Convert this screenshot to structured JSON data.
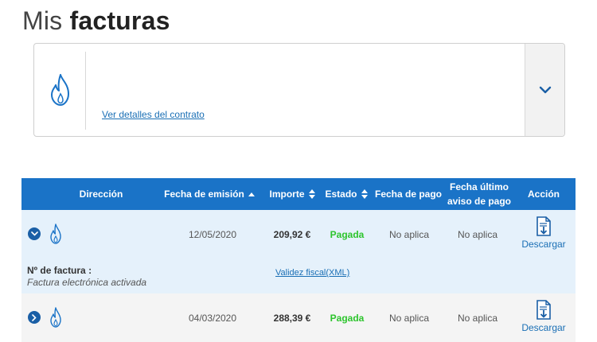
{
  "page": {
    "title_light": "Mis",
    "title_bold": "facturas"
  },
  "contract": {
    "details_link": "Ver detalles del contrato",
    "icon": "gas-flame-icon",
    "toggle_icon": "chevron-down-icon"
  },
  "table": {
    "headers": {
      "direccion": "Dirección",
      "fecha_emision": "Fecha de emisión",
      "importe": "Importe",
      "estado": "Estado",
      "fecha_pago": "Fecha de pago",
      "fecha_aviso_line1": "Fecha último",
      "fecha_aviso_line2": "aviso de pago",
      "accion": "Acción"
    },
    "rows": [
      {
        "fecha_emision": "12/05/2020",
        "importe": "209,92 €",
        "estado": "Pagada",
        "fecha_pago": "No aplica",
        "fecha_aviso": "No aplica",
        "accion": "Descargar",
        "expanded": true,
        "invoice_label": "Nº de factura :",
        "invoice_note": "Factura electrónica activada",
        "xml_link": "Validez fiscal(XML)"
      },
      {
        "fecha_emision": "04/03/2020",
        "importe": "288,39 €",
        "estado": "Pagada",
        "fecha_pago": "No aplica",
        "fecha_aviso": "No aplica",
        "accion": "Descargar",
        "expanded": false
      }
    ]
  },
  "colors": {
    "header_blue": "#1a73c7",
    "status_green": "#2cc42c",
    "link_blue": "#1a6fb5",
    "row_expanded": "#e5f1fb",
    "row_alt": "#f4f4f4"
  }
}
